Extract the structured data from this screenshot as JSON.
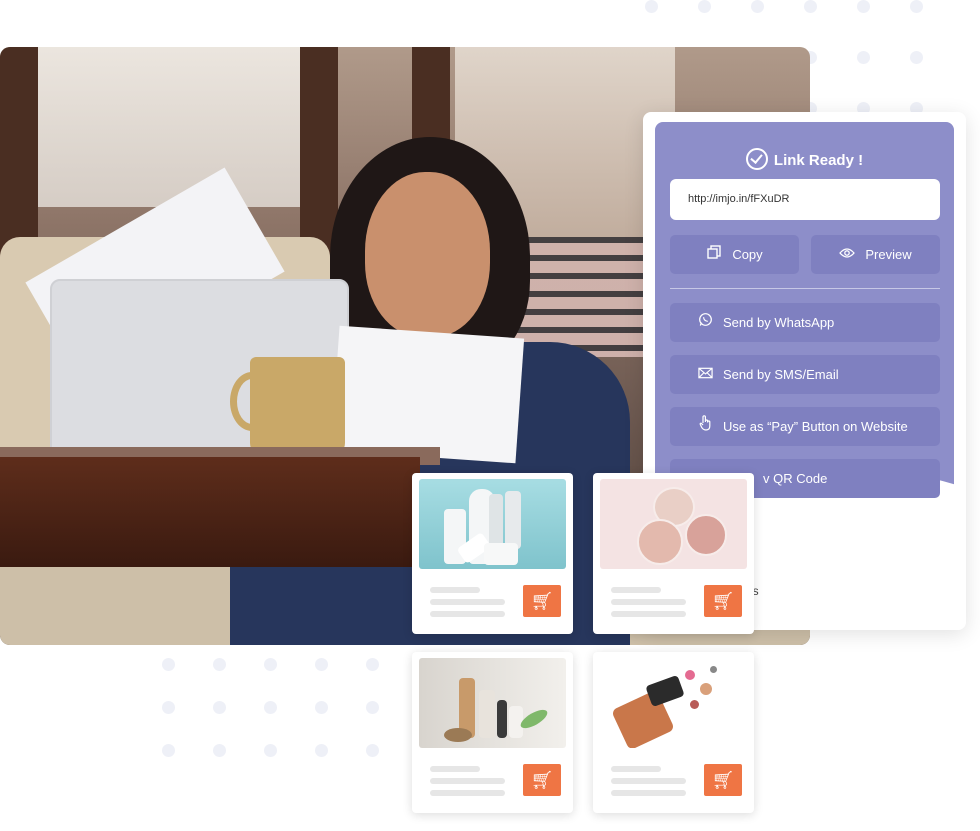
{
  "panel": {
    "title": "Link Ready !",
    "url": "http://imjo.in/fFXuDR",
    "copy_label": "Copy",
    "preview_label": "Preview",
    "actions": [
      {
        "label": "Send by WhatsApp",
        "icon": "whatsapp-icon"
      },
      {
        "label": "Send by SMS/Email",
        "icon": "mail-icon"
      },
      {
        "label": "Use as “Pay” Button on Website",
        "icon": "hand-pointer-icon"
      },
      {
        "label": "v QR Code",
        "icon": "qr-code-icon"
      }
    ],
    "footer_fragment": "nks",
    "colors": {
      "panel": "#8d8ec9",
      "button": "#7f80c0",
      "cart": "#ef7544"
    }
  },
  "products": [
    {
      "image": "skincare-bottles"
    },
    {
      "image": "face-cream-jars"
    },
    {
      "image": "cosmetic-bottles-with-leaves"
    },
    {
      "image": "makeup-bag"
    }
  ]
}
